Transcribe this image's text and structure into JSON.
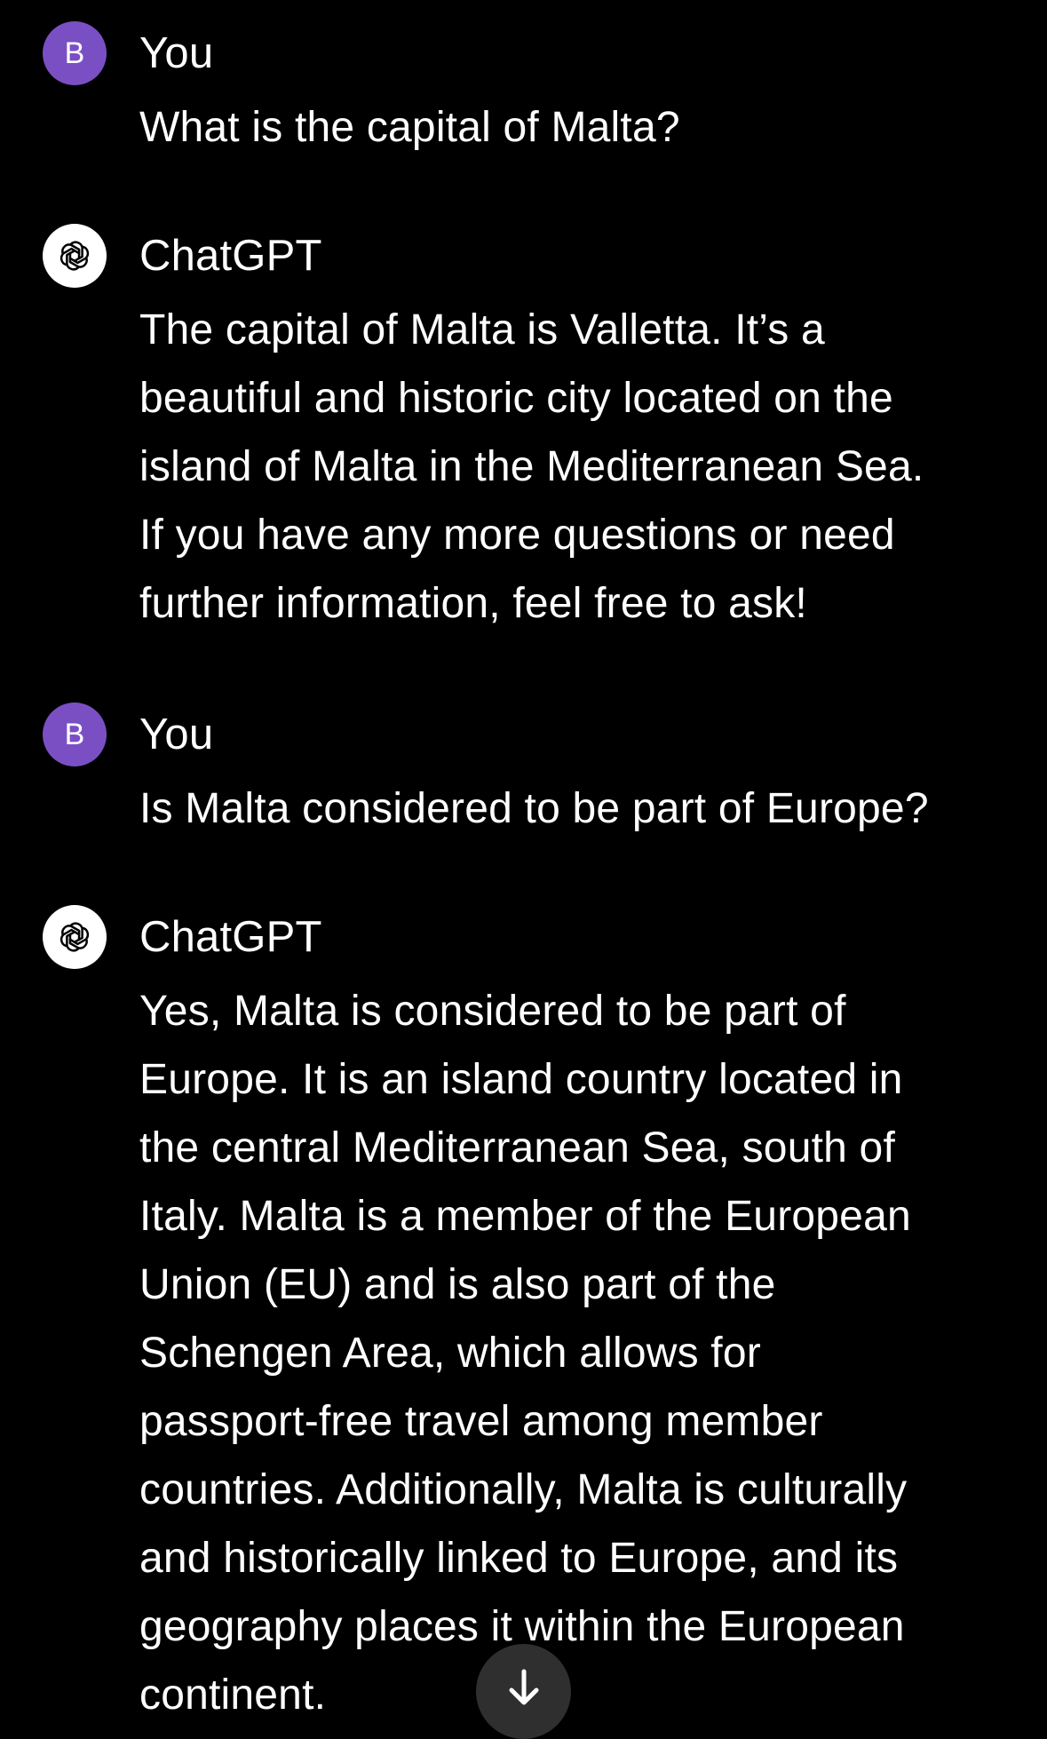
{
  "messages": [
    {
      "author": "You",
      "avatar_letter": "B",
      "text": "What is the capital of Malta?"
    },
    {
      "author": "ChatGPT",
      "avatar_icon": "openai-logo-icon",
      "text": "The capital of Malta is Valletta. It’s a\nbeautiful and historic city located on the\nisland of Malta in the Mediterranean Sea.\nIf you have any more questions or need\nfurther information, feel free to ask!"
    },
    {
      "author": "You",
      "avatar_letter": "B",
      "text": "Is Malta considered to be part of Europe?"
    },
    {
      "author": "ChatGPT",
      "avatar_icon": "openai-logo-icon",
      "text": "Yes, Malta is considered to be part of\nEurope. It is an island country located in\nthe central Mediterranean Sea, south of\nItaly. Malta is a member of the European\nUnion (EU) and is also part of the\nSchengen Area, which allows for\npassport-free travel among member\ncountries. Additionally, Malta is culturally\nand historically linked to Europe, and its\ngeography places it within the European\ncontinent."
    }
  ],
  "scroll_button": {
    "icon": "arrow-down-icon"
  },
  "colors": {
    "background": "#000000",
    "user_avatar": "#7b4fc4",
    "bot_avatar": "#ffffff",
    "text": "#ffffff",
    "scroll_button": "#2f2f2f"
  }
}
